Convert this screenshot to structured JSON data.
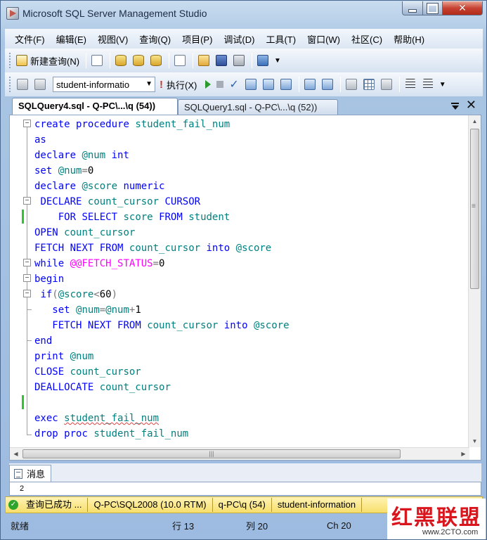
{
  "window": {
    "title": "Microsoft SQL Server Management Studio"
  },
  "menu": [
    "文件(F)",
    "编辑(E)",
    "视图(V)",
    "查询(Q)",
    "项目(P)",
    "调试(D)",
    "工具(T)",
    "窗口(W)",
    "社区(C)",
    "帮助(H)"
  ],
  "toolbar": {
    "new_query_label": "新建查询(N)",
    "database_select": "student-informatio",
    "execute_label": "执行(X)"
  },
  "tabs": [
    {
      "label": "SQLQuery4.sql - Q-PC\\...\\q (54))",
      "active": true
    },
    {
      "label": "SQLQuery1.sql - Q-PC\\...\\q (52))",
      "active": false
    }
  ],
  "editor": {
    "lines": [
      "create procedure student_fail_num",
      "as",
      "declare @num int",
      "set @num=0",
      "declare @score numeric",
      " DECLARE count_cursor CURSOR",
      "    FOR SELECT score FROM student",
      "OPEN count_cursor",
      "FETCH NEXT FROM count_cursor into @score",
      "while @@FETCH_STATUS=0",
      "begin",
      " if(@score<60)",
      "   set @num=@num+1",
      "   FETCH NEXT FROM count_cursor into @score",
      "end",
      "print @num",
      "CLOSE count_cursor",
      "DEALLOCATE count_cursor",
      "",
      "exec student_fail_num",
      "drop proc student_fail_num"
    ]
  },
  "results": {
    "tab_label": "消息",
    "output": "2"
  },
  "query_status": {
    "state": "查询已成功 ...",
    "server": "Q-PC\\SQL2008 (10.0 RTM)",
    "user": "q-PC\\q (54)",
    "database": "student-information"
  },
  "status": {
    "ready": "就绪",
    "row": "行 13",
    "col": "列 20",
    "ch": "Ch 20"
  },
  "watermark": {
    "title": "红黑联盟",
    "url": "www.2CTO.com"
  },
  "colors": {
    "keyword": "#0000ff",
    "identifier": "#008080",
    "system_function": "#ff00ff",
    "status_bar": "#f7df6b"
  }
}
